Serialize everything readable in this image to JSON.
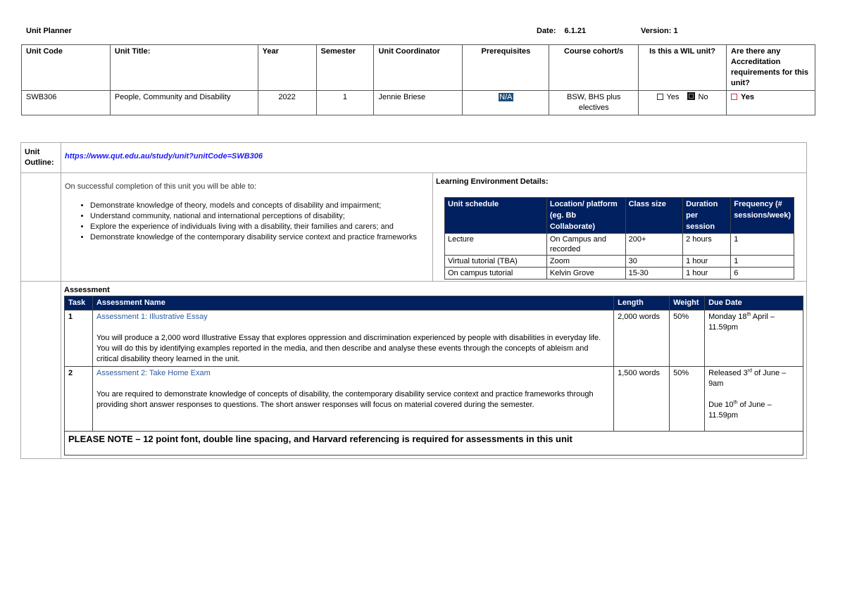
{
  "header": {
    "title": "Unit Planner",
    "date_label": "Date:",
    "date_value": "6.1.21",
    "version_label": "Version:",
    "version_value": "1"
  },
  "unit_info": {
    "headers": [
      "Unit Code",
      "Unit Title:",
      "Year",
      "Semester",
      "Unit Coordinator",
      "Prerequisites",
      "Course cohort/s",
      "Is this a WIL unit?",
      "Are there any Accreditation requirements for this unit?"
    ],
    "unit_code": "SWB306",
    "unit_title": "People, Community and Disability",
    "year": "2022",
    "semester": "1",
    "coordinator": "Jennie Briese",
    "prerequisites": "N/A",
    "cohorts": "BSW, BHS plus electives",
    "wil": {
      "yes_label": "Yes",
      "yes_checked": false,
      "no_label": "No",
      "no_checked": true
    },
    "accreditation": {
      "yes_label": "Yes",
      "yes_checked": false
    }
  },
  "outline": {
    "label": "Unit Outline:",
    "url": "https://www.qut.edu.au/study/unit?unitCode=SWB306",
    "outcomes_intro": "On successful completion of this unit you will be able to:",
    "outcomes": [
      "Demonstrate knowledge of theory, models and concepts of disability and impairment;",
      "Understand community, national and international perceptions of disability;",
      "Explore the experience of individuals living with a disability, their families and carers; and",
      "Demonstrate knowledge of the contemporary disability service context and practice frameworks"
    ]
  },
  "learning_environment": {
    "title": "Learning Environment Details:",
    "headers": [
      "Unit schedule",
      "Location/ platform (eg. Bb Collaborate)",
      "Class size",
      "Duration per session",
      "Frequency (# sessions/week)"
    ],
    "rows": [
      [
        "Lecture",
        "On Campus and recorded",
        "200+",
        "2 hours",
        "1"
      ],
      [
        "Virtual tutorial (TBA)",
        "Zoom",
        "30",
        "1 hour",
        "1"
      ],
      [
        "On campus tutorial",
        "Kelvin Grove",
        "15-30",
        "1 hour",
        "6"
      ]
    ]
  },
  "assessment": {
    "title": "Assessment",
    "headers": [
      "Task",
      "Assessment Name",
      "Length",
      "Weight",
      "Due Date"
    ],
    "items": [
      {
        "task": "1",
        "name": "Assessment 1: Illustrative Essay",
        "description": "You will produce a 2,000 word Illustrative Essay that explores oppression and discrimination experienced by people with disabilities in everyday life. You will do this by identifying examples reported in the media, and then describe and analyse these events through the concepts of ableism and critical disability theory learned in the unit.",
        "length": "2,000 words",
        "weight": "50%",
        "due_a_pre": "Monday 18",
        "due_a_sup": "th",
        "due_a_post": " April – 11.59pm"
      },
      {
        "task": "2",
        "name": "Assessment 2: Take Home Exam",
        "description": "You are required to demonstrate knowledge of concepts of disability, the contemporary disability service context and practice frameworks through providing short answer responses to questions. The short answer responses will focus on material covered during the semester.",
        "length": "1,500 words",
        "weight": "50%",
        "release_pre": "Released 3",
        "release_sup": "rd",
        "release_post": " of June – 9am",
        "due_pre": "Due 10",
        "due_sup": "th",
        "due_post": " of June – 11.59pm"
      }
    ],
    "note": "PLEASE NOTE – 12 point font, double line spacing, and Harvard referencing is required for assessments in this unit"
  },
  "colors": {
    "header_navy": "#002060",
    "link_blue": "#1a1aff",
    "assessment_name_blue": "#2e5a9e",
    "highlight_navy": "#1f4e79",
    "checkbox_red": "#e03030"
  }
}
